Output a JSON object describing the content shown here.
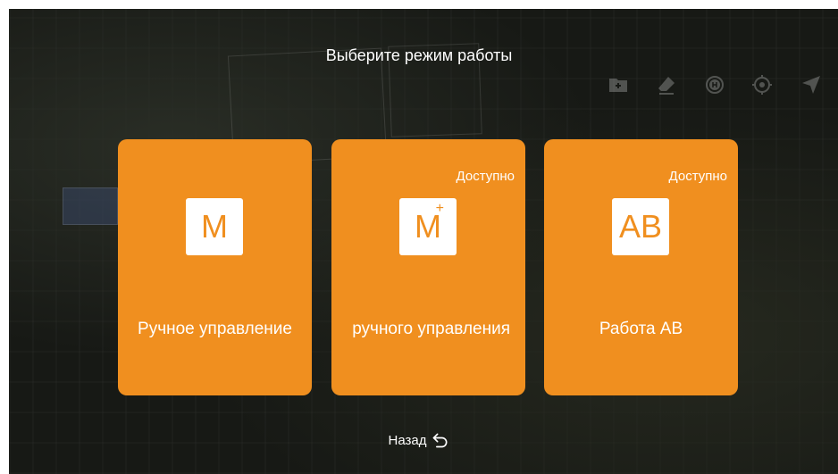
{
  "header": {
    "title": "Выберите режим работы"
  },
  "toolbar": {
    "icons": [
      "folder-add-icon",
      "eraser-icon",
      "home-point-icon",
      "locate-icon",
      "navigation-arrow-icon"
    ]
  },
  "modes": [
    {
      "icon_text": "M",
      "icon": "manual-mode-icon",
      "label": "Ручное управление",
      "badge": ""
    },
    {
      "icon_text": "M",
      "icon": "manual-plus-mode-icon",
      "label": "ручного управления",
      "badge": "Доступно"
    },
    {
      "icon_text": "AB",
      "icon": "ab-mode-icon",
      "label": "Работа AB",
      "badge": "Доступно"
    }
  ],
  "footer": {
    "back_label": "Назад",
    "back_icon": "return-arrow-icon"
  },
  "colors": {
    "card": "#f08f1f",
    "background": "#171915",
    "text": "#ffffff"
  }
}
